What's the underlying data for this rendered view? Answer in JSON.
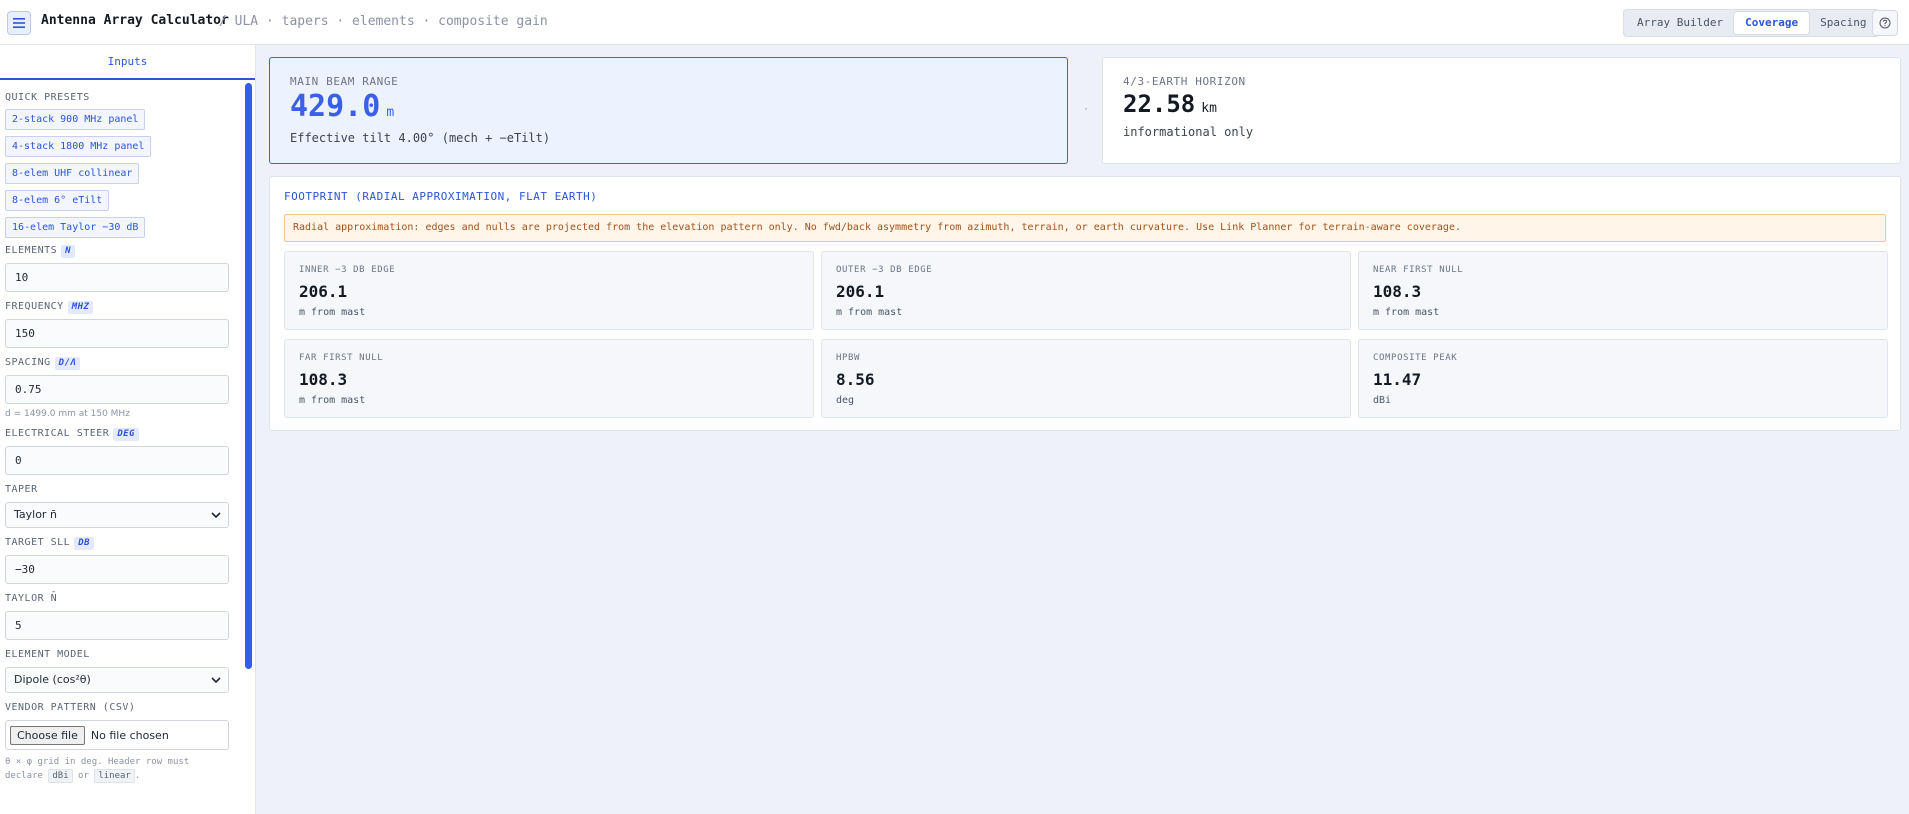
{
  "header": {
    "title": "Antenna Array Calculator",
    "breadcrumb": "/ ULA · tapers · elements · composite gain",
    "nav": [
      "Array Builder",
      "Coverage",
      "Spacing"
    ],
    "active_nav": "Coverage"
  },
  "sidebar": {
    "tab": "Inputs",
    "presets_label": "QUICK PRESETS",
    "presets": [
      "2-stack 900 MHz panel",
      "4-stack 1800 MHz panel",
      "8-elem UHF collinear",
      "8-elem 6° eTilt",
      "16-elem Taylor −30 dB"
    ],
    "fields": {
      "elements": {
        "label": "ELEMENTS",
        "unit": "N",
        "value": "10"
      },
      "frequency": {
        "label": "FREQUENCY",
        "unit": "MHZ",
        "value": "150"
      },
      "spacing": {
        "label": "SPACING",
        "unit": "D/Λ",
        "value": "0.75",
        "hint": "d = 1499.0 mm at 150 MHz"
      },
      "steer": {
        "label": "ELECTRICAL STEER",
        "unit": "DEG",
        "value": "0"
      },
      "taper": {
        "label": "TAPER",
        "value": "Taylor n̄"
      },
      "sll": {
        "label": "TARGET SLL",
        "unit": "DB",
        "value": "−30"
      },
      "taylor_n": {
        "label": "TAYLOR N̄",
        "value": "5"
      },
      "element_model": {
        "label": "ELEMENT MODEL",
        "value": "Dipole (cos²θ)"
      },
      "vendor": {
        "label": "VENDOR PATTERN (CSV)",
        "button": "Choose file",
        "status": "No file chosen",
        "hint_pre": "θ × φ grid in deg. Header row must",
        "hint_declare": "declare",
        "chip1": "dBi",
        "hint_or": "or",
        "chip2": "linear",
        "hint_end": "."
      }
    }
  },
  "main_beam": {
    "label": "MAIN BEAM RANGE",
    "value": "429.0",
    "unit": "m",
    "sub": "Effective tilt 4.00° (mech + −eTilt)"
  },
  "separator": "·",
  "horizon": {
    "label": "4/3-EARTH HORIZON",
    "value": "22.58",
    "unit": "km",
    "sub": "informational only"
  },
  "footprint": {
    "title": "FOOTPRINT (RADIAL APPROXIMATION, FLAT EARTH)",
    "notice": "Radial approximation: edges and nulls are projected from the elevation pattern only. No fwd/back asymmetry from azimuth, terrain, or earth curvature. Use Link Planner for terrain-aware coverage.",
    "metrics": [
      {
        "label": "INNER −3 DB EDGE",
        "value": "206.1",
        "unit": "m from mast"
      },
      {
        "label": "OUTER −3 DB EDGE",
        "value": "206.1",
        "unit": "m from mast"
      },
      {
        "label": "NEAR FIRST NULL",
        "value": "108.3",
        "unit": "m from mast"
      },
      {
        "label": "FAR FIRST NULL",
        "value": "108.3",
        "unit": "m from mast"
      },
      {
        "label": "HPBW",
        "value": "8.56",
        "unit": "deg"
      },
      {
        "label": "COMPOSITE PEAK",
        "value": "11.47",
        "unit": "dBi"
      }
    ]
  },
  "colors": {
    "accent": "#2b55d8",
    "notice_bg": "#fff5e8",
    "notice_text": "#a0521d"
  },
  "icons": {
    "menu": "hamburger-icon",
    "help": "help-icon",
    "select": "chevron-down-icon"
  }
}
